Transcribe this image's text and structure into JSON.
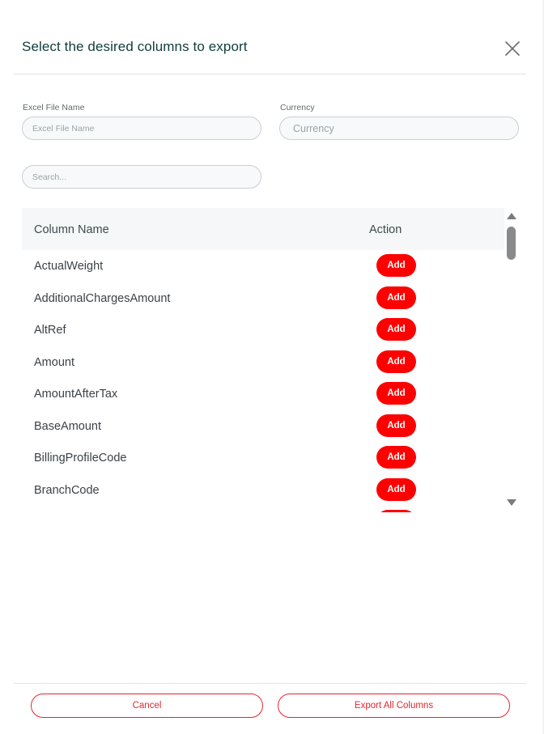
{
  "dialog": {
    "title": "Select the desired columns to export",
    "close_icon": "close-icon"
  },
  "form": {
    "file_name": {
      "label": "Excel File Name",
      "placeholder": "Excel File Name",
      "value": ""
    },
    "currency": {
      "label": "Currency",
      "placeholder": "Currency",
      "value": ""
    },
    "search": {
      "placeholder": "Search...",
      "value": ""
    }
  },
  "table": {
    "headers": {
      "column_name": "Column Name",
      "action": "Action"
    },
    "rows": [
      {
        "name": "ActualWeight",
        "action": "Add"
      },
      {
        "name": "AdditionalChargesAmount",
        "action": "Add"
      },
      {
        "name": "AltRef",
        "action": "Add"
      },
      {
        "name": "Amount",
        "action": "Add"
      },
      {
        "name": "AmountAfterTax",
        "action": "Add"
      },
      {
        "name": "BaseAmount",
        "action": "Add"
      },
      {
        "name": "BillingProfileCode",
        "action": "Add"
      },
      {
        "name": "BranchCode",
        "action": "Add"
      },
      {
        "name": "",
        "action": ""
      }
    ]
  },
  "footer": {
    "cancel_label": "Cancel",
    "export_all_label": "Export All Columns"
  },
  "colors": {
    "title": "#0f3d3a",
    "add_button": "#ff0000",
    "footer_accent": "#e3262f",
    "table_header_bg": "#f5f7f8"
  }
}
